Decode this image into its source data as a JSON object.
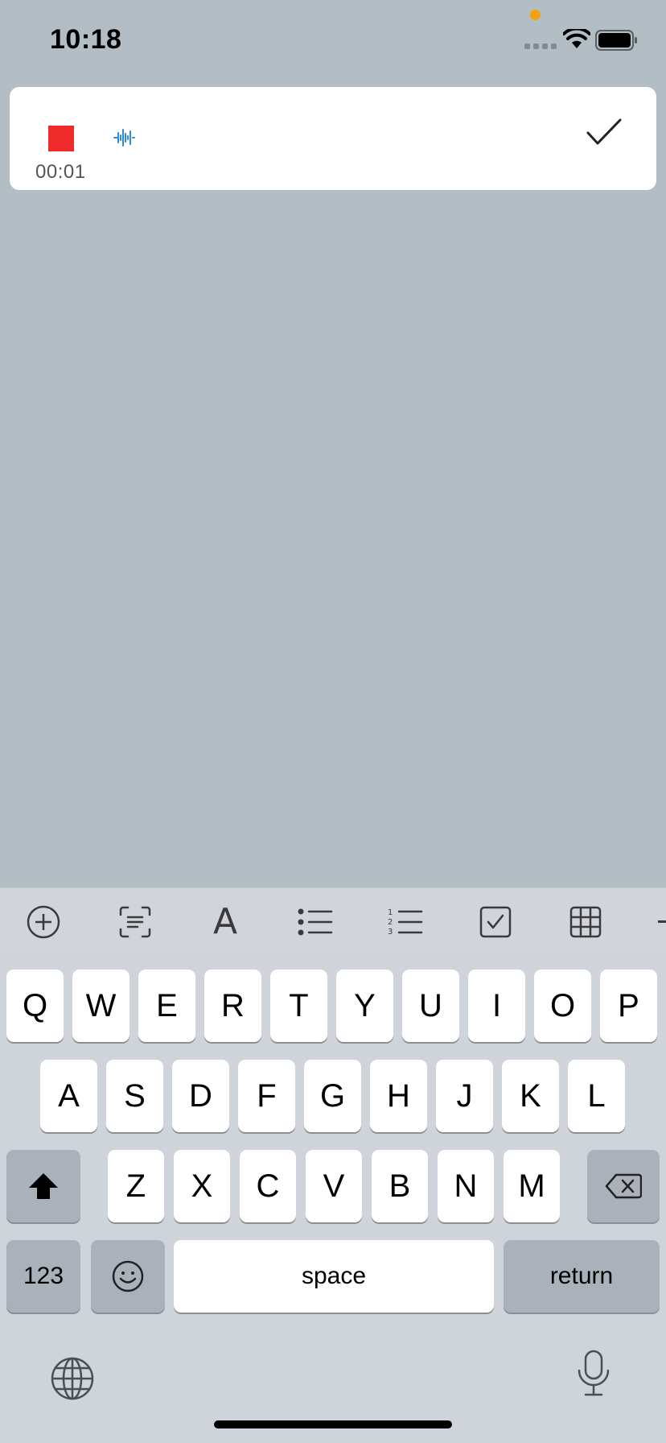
{
  "status_bar": {
    "time": "10:18",
    "indicator_color": "#f4a20c"
  },
  "recording": {
    "timer": "00:01",
    "stop_color": "#ef2a2a",
    "waveform_color": "#2c8be0"
  },
  "toolbar": {
    "text_format_glyph": "A",
    "items": [
      "add-icon",
      "scan-text-icon",
      "text-format-icon",
      "bulleted-list-icon",
      "numbered-list-icon",
      "checklist-icon",
      "table-icon"
    ]
  },
  "keyboard": {
    "row1": [
      "Q",
      "W",
      "E",
      "R",
      "T",
      "Y",
      "U",
      "I",
      "O",
      "P"
    ],
    "row2": [
      "A",
      "S",
      "D",
      "F",
      "G",
      "H",
      "J",
      "K",
      "L"
    ],
    "row3": [
      "Z",
      "X",
      "C",
      "V",
      "B",
      "N",
      "M"
    ],
    "numbers_label": "123",
    "space_label": "space",
    "return_label": "return"
  }
}
